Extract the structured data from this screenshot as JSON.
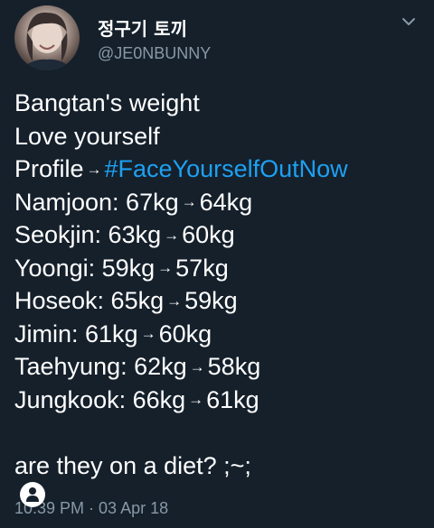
{
  "header": {
    "display_name": "정구기 토끼",
    "handle": "@JE0NBUNNY"
  },
  "tweet": {
    "lines": [
      "Bangtan's weight",
      "Love yourself"
    ],
    "profile": {
      "label": "Profile",
      "arrow": "→",
      "hashtag": "#FaceYourselfOutNow"
    },
    "weights": [
      {
        "label": "Namjoon: 67kg",
        "arrow": "→",
        "after": "64kg"
      },
      {
        "label": "Seokjin: 63kg",
        "arrow": "→",
        "after": "60kg"
      },
      {
        "label": "Yoongi: 59kg",
        "arrow": "→",
        "after": "57kg"
      },
      {
        "label": "Hoseok: 65kg",
        "arrow": "→",
        "after": "59kg"
      },
      {
        "label": "Jimin: 61kg",
        "arrow": "→",
        "after": "60kg"
      },
      {
        "label": "Taehyung: 62kg",
        "arrow": "→",
        "after": "58kg"
      },
      {
        "label": "Jungkook: 66kg",
        "arrow": "→",
        "after": "61kg"
      }
    ],
    "closing": "are they on a diet? ;~;",
    "timestamp": "10:39 PM · 03 Apr 18"
  },
  "colors": {
    "background": "#15202b",
    "text": "#ffffff",
    "secondary": "#8899a6",
    "link": "#1da1f2"
  },
  "icons": {
    "menu": "chevron-down-icon",
    "floating": "person-icon"
  }
}
